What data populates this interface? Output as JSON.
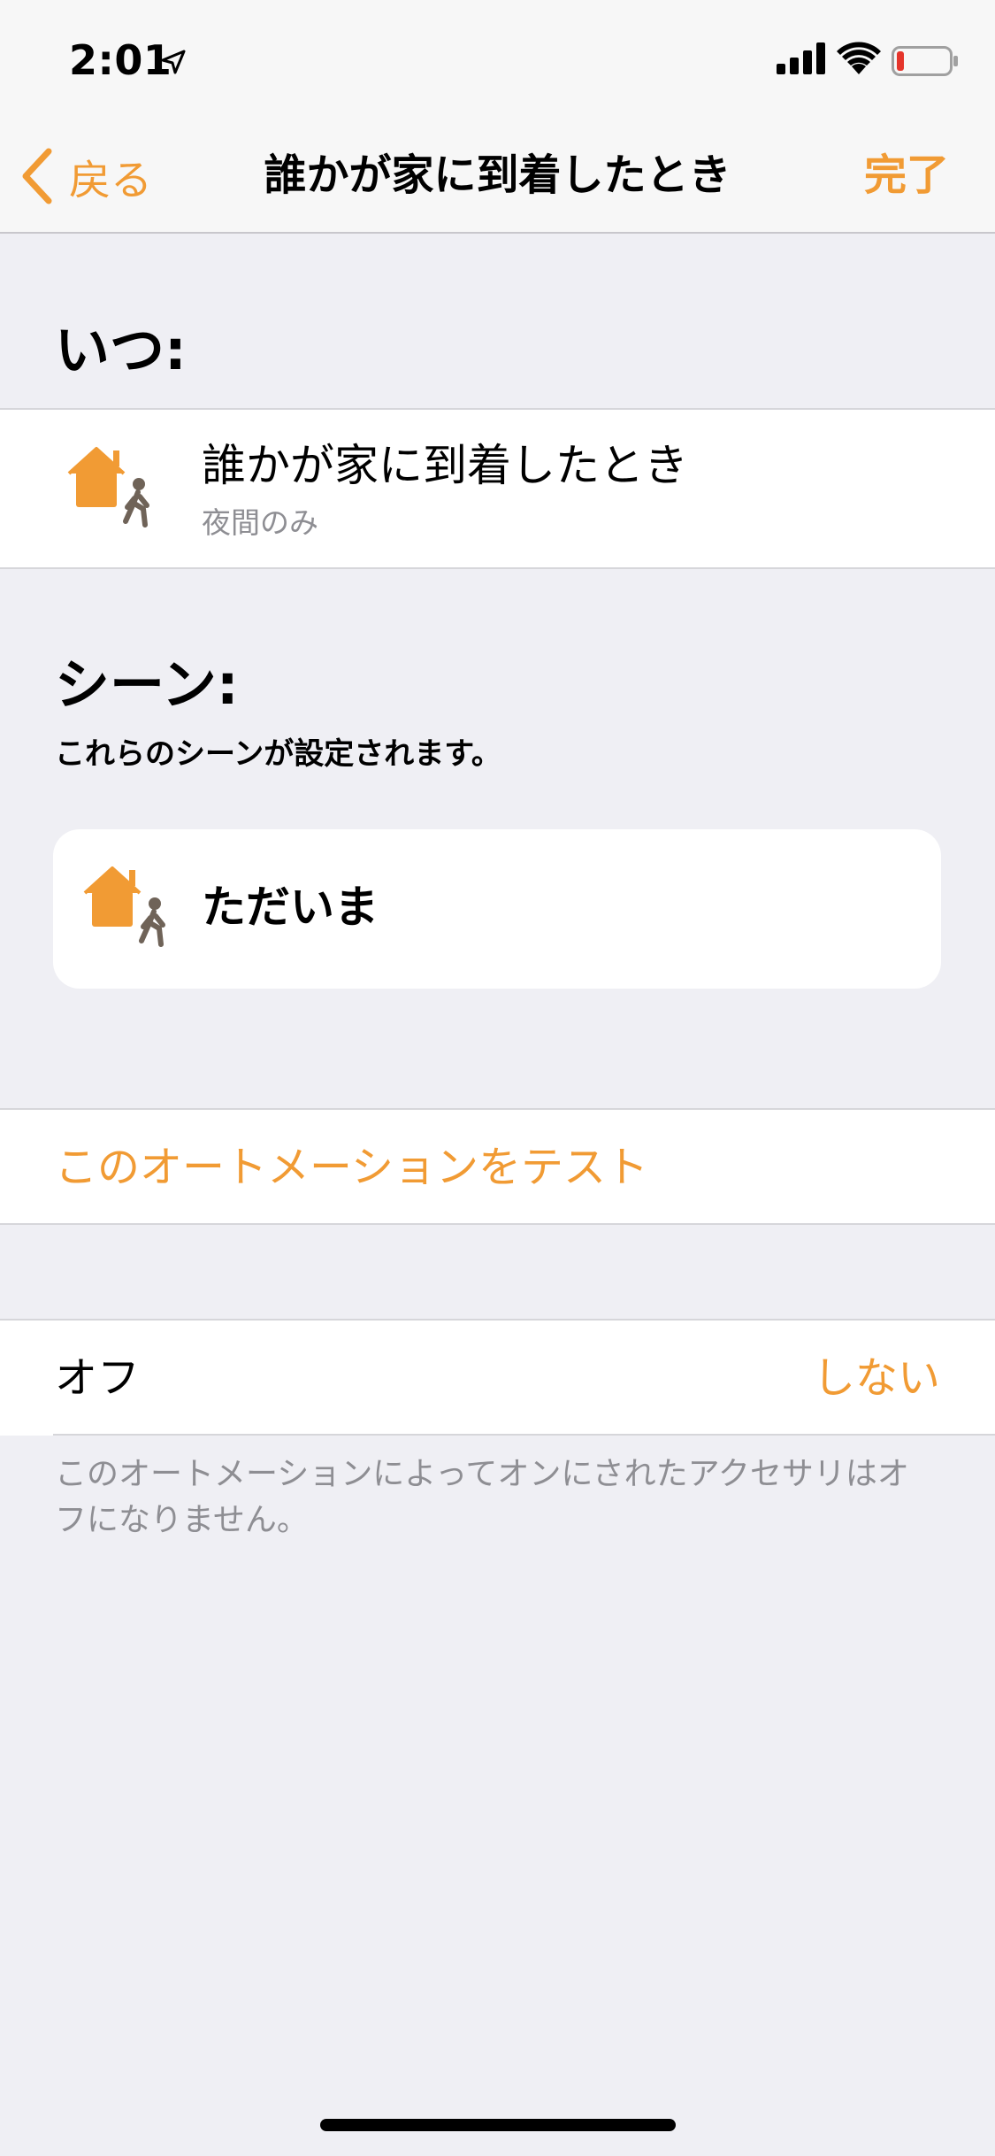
{
  "status_bar": {
    "time": "2:01",
    "location_icon": "location-arrow-icon",
    "signal_icon": "cellular-signal-icon",
    "wifi_icon": "wifi-icon",
    "battery_icon": "battery-low-icon"
  },
  "nav": {
    "back_label": "戻る",
    "title": "誰かが家に到着したとき",
    "done_label": "完了"
  },
  "when_section": {
    "title": "いつ:",
    "trigger": {
      "title": "誰かが家に到着したとき",
      "subtitle": "夜間のみ",
      "icon": "home-arrival-icon"
    }
  },
  "scenes_section": {
    "title": "シーン:",
    "subtitle": "これらのシーンが設定されます。",
    "scenes": [
      {
        "label": "ただいま",
        "icon": "home-arrival-icon"
      }
    ]
  },
  "test": {
    "label": "このオートメーションをテスト"
  },
  "off": {
    "label": "オフ",
    "value": "しない",
    "footnote": "このオートメーションによってオンにされたアクセサリはオフになりません。"
  },
  "colors": {
    "accent": "#f19b34",
    "background": "#efeff4",
    "secondary_text": "#8e8e93",
    "battery_low": "#e5352b",
    "person": "#6f6358"
  }
}
